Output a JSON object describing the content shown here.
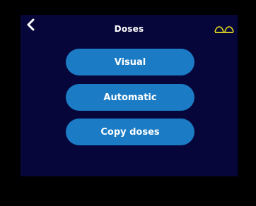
{
  "header": {
    "title": "Doses",
    "back_icon": "chevron-left-icon",
    "glasses_icon": "glasses-icon",
    "glasses_color": "#e8e01a"
  },
  "menu": {
    "items": [
      {
        "label": "Visual"
      },
      {
        "label": "Automatic"
      },
      {
        "label": "Copy doses"
      }
    ],
    "button_color": "#1b7bc4"
  },
  "theme": {
    "screen_background": "#06063a",
    "bezel": "#000000"
  }
}
